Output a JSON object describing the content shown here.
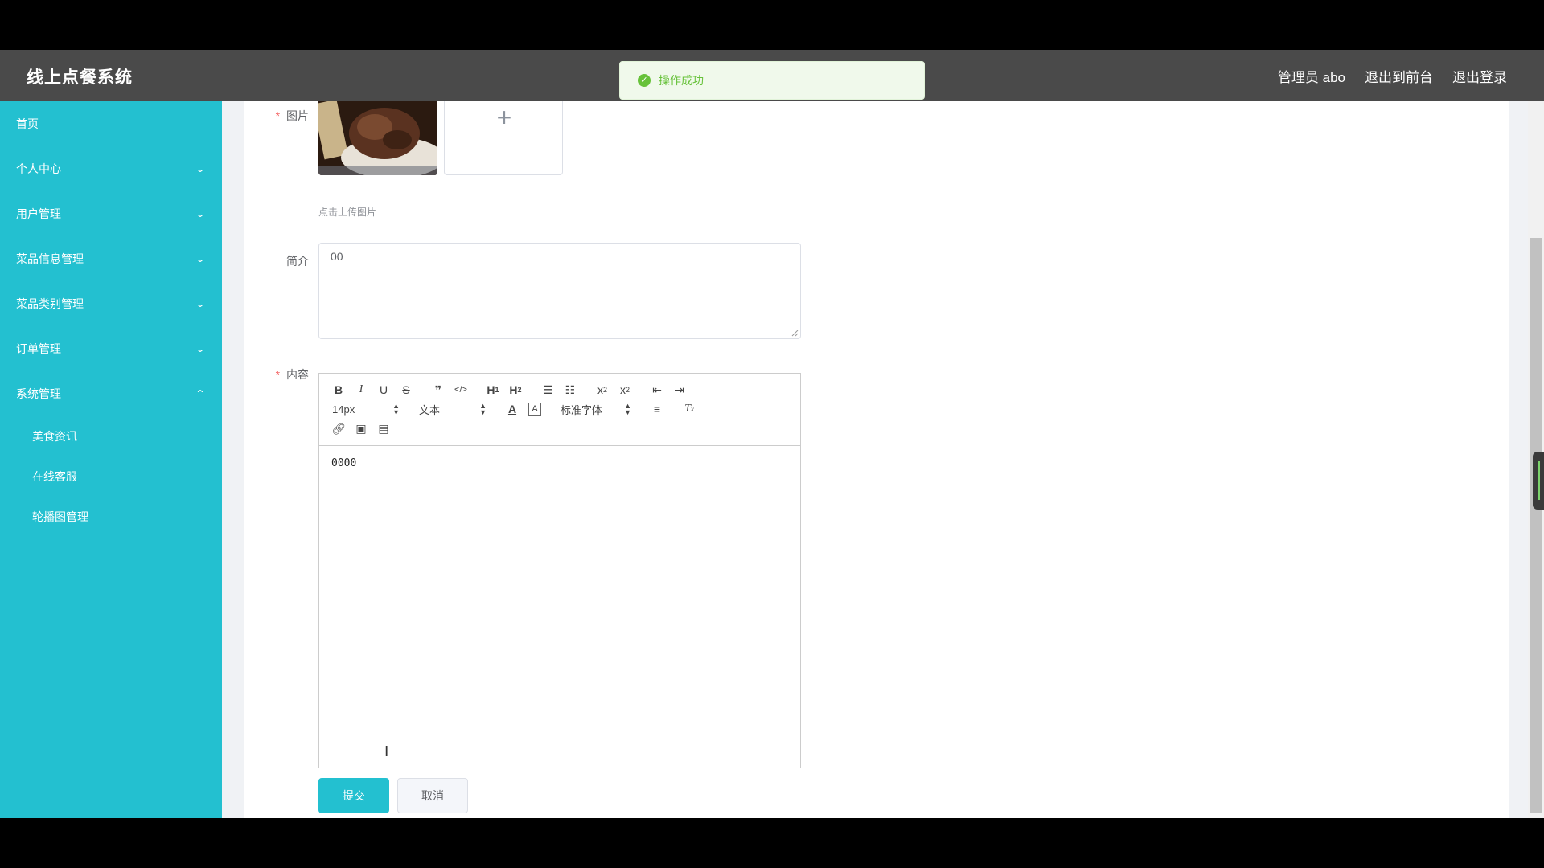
{
  "header": {
    "title": "线上点餐系统",
    "links": [
      "管理员 abo",
      "退出到前台",
      "退出登录"
    ]
  },
  "toast": {
    "text": "操作成功",
    "icon": "success-check-icon"
  },
  "sidebar": {
    "items": [
      {
        "label": "首页",
        "expandable": false
      },
      {
        "label": "个人中心",
        "expandable": true
      },
      {
        "label": "用户管理",
        "expandable": true
      },
      {
        "label": "菜品信息管理",
        "expandable": true
      },
      {
        "label": "菜品类别管理",
        "expandable": true
      },
      {
        "label": "订单管理",
        "expandable": true
      },
      {
        "label": "系统管理",
        "expandable": true,
        "expanded": true
      }
    ],
    "subitems": [
      "美食资讯",
      "在线客服",
      "轮播图管理"
    ]
  },
  "form": {
    "image_label": "图片",
    "upload_hint": "点击上传图片",
    "intro_label": "简介",
    "intro_value": "00",
    "content_label": "内容",
    "content_value": "0000"
  },
  "editor": {
    "font_size": "14px",
    "text_type": "文本",
    "font_family": "标准字体"
  },
  "buttons": {
    "submit": "提交",
    "cancel": "取消"
  },
  "colors": {
    "sidebar": "#23c0d0",
    "header": "#4a4a4a",
    "success": "#67c23a",
    "required": "#f56c6c"
  }
}
